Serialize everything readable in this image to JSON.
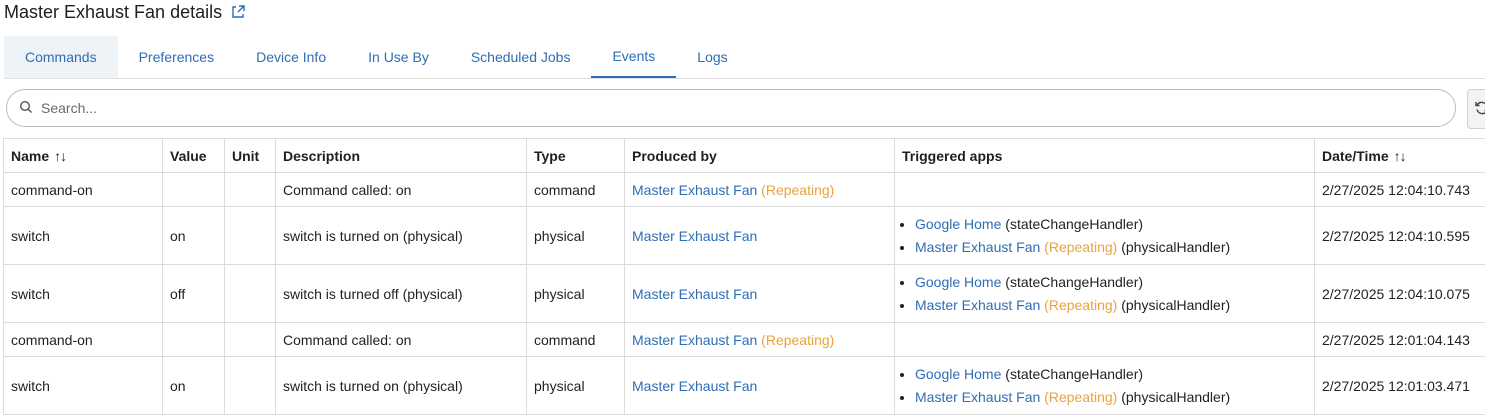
{
  "header": {
    "title": "Master Exhaust Fan details",
    "external_link_icon": "external-link-icon"
  },
  "tabs": [
    {
      "label": "Commands"
    },
    {
      "label": "Preferences"
    },
    {
      "label": "Device Info"
    },
    {
      "label": "In Use By"
    },
    {
      "label": "Scheduled Jobs"
    },
    {
      "label": "Events",
      "active": true
    },
    {
      "label": "Logs"
    }
  ],
  "search": {
    "placeholder": "Search...",
    "value": ""
  },
  "table": {
    "columns": {
      "name": "Name",
      "value": "Value",
      "unit": "Unit",
      "description": "Description",
      "type": "Type",
      "produced_by": "Produced by",
      "triggered_apps": "Triggered apps",
      "datetime": "Date/Time"
    },
    "sort_glyph": "↑↓",
    "rows": [
      {
        "name": "command-on",
        "value": "",
        "unit": "",
        "description": "Command called: on",
        "type": "command",
        "produced_by": "Master Exhaust Fan",
        "produced_suffix": "(Repeating)",
        "datetime": "2/27/2025 12:04:10.743"
      },
      {
        "name": "switch",
        "value": "on",
        "unit": "",
        "description": "switch is turned on (physical)",
        "type": "physical",
        "produced_by": "Master Exhaust Fan",
        "produced_suffix": "",
        "apps": [
          {
            "name": "Google Home",
            "tag": "",
            "handler": "(stateChangeHandler)"
          },
          {
            "name": "Master Exhaust Fan",
            "tag": "(Repeating)",
            "handler": "(physicalHandler)"
          }
        ],
        "datetime": "2/27/2025 12:04:10.595"
      },
      {
        "name": "switch",
        "value": "off",
        "unit": "",
        "description": "switch is turned off (physical)",
        "type": "physical",
        "produced_by": "Master Exhaust Fan",
        "produced_suffix": "",
        "apps": [
          {
            "name": "Google Home",
            "tag": "",
            "handler": "(stateChangeHandler)"
          },
          {
            "name": "Master Exhaust Fan",
            "tag": "(Repeating)",
            "handler": "(physicalHandler)"
          }
        ],
        "datetime": "2/27/2025 12:04:10.075"
      },
      {
        "name": "command-on",
        "value": "",
        "unit": "",
        "description": "Command called: on",
        "type": "command",
        "produced_by": "Master Exhaust Fan",
        "produced_suffix": "(Repeating)",
        "datetime": "2/27/2025 12:01:04.143"
      },
      {
        "name": "switch",
        "value": "on",
        "unit": "",
        "description": "switch is turned on (physical)",
        "type": "physical",
        "produced_by": "Master Exhaust Fan",
        "produced_suffix": "",
        "apps": [
          {
            "name": "Google Home",
            "tag": "",
            "handler": "(stateChangeHandler)"
          },
          {
            "name": "Master Exhaust Fan",
            "tag": "(Repeating)",
            "handler": "(physicalHandler)"
          }
        ],
        "datetime": "2/27/2025 12:01:03.471"
      }
    ]
  },
  "colors": {
    "link": "#2f6db5",
    "repeating": "#e8a33d",
    "active_tab": "#2f6db5"
  }
}
